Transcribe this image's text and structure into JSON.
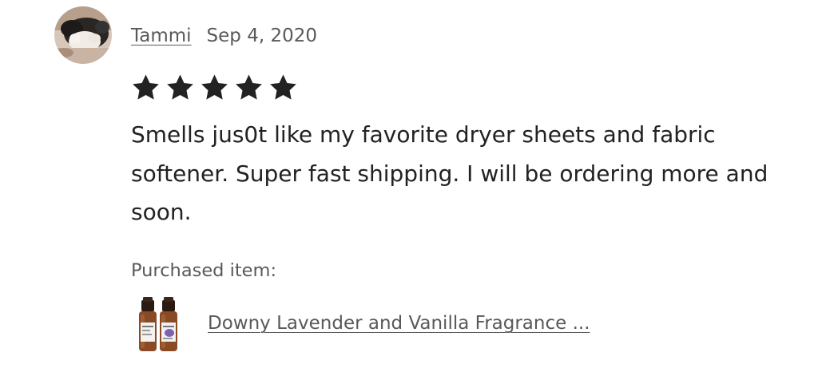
{
  "review": {
    "reviewer_name": "Tammi",
    "date": "Sep 4, 2020",
    "rating": 5,
    "rating_max": 5,
    "text": "Smells jus0t like my favorite dryer sheets and fabric softener. Super fast shipping. I will be ordering more and soon.",
    "purchased_label": "Purchased item:",
    "item_title": "Downy Lavender and Vanilla Fragrance ..."
  },
  "icons": {
    "avatar": "cat-photo-avatar",
    "star": "star-icon",
    "item_thumbnail": "fragrance-oil-bottles"
  },
  "colors": {
    "text": "#222222",
    "muted_text": "#595959",
    "star": "#222222"
  }
}
